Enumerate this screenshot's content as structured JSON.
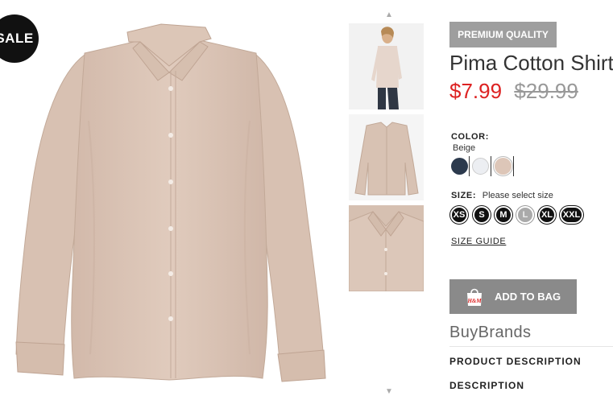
{
  "badges": {
    "sale": "SALE",
    "premium": "PREMIUM QUALITY"
  },
  "product": {
    "title": "Pima Cotton Shirt",
    "price_sale": "$7.99",
    "price_original": "$29.99"
  },
  "color": {
    "label": "COLOR:",
    "selected": "Beige",
    "swatches": [
      {
        "name": "navy",
        "hex": "#2c3a4d"
      },
      {
        "name": "white",
        "hex": "#eceef2"
      },
      {
        "name": "beige",
        "hex": "#ddc6b8"
      }
    ]
  },
  "size": {
    "label": "SIZE:",
    "hint": "Please select size",
    "options": [
      "XS",
      "S",
      "M",
      "L",
      "XL",
      "XXL"
    ],
    "disabled": [
      "L"
    ]
  },
  "links": {
    "size_guide": "SIZE GUIDE"
  },
  "actions": {
    "add_to_bag": "ADD TO BAG",
    "bag_logo": "H&M"
  },
  "brand": "BuyBrands",
  "sections": {
    "product_description": "PRODUCT DESCRIPTION",
    "description": "DESCRIPTION"
  },
  "colors": {
    "sale_price": "#dd2222",
    "badge_grey": "#9e9e9e",
    "button_grey": "#8a8a8a",
    "shirt": "#d9c3b4"
  }
}
